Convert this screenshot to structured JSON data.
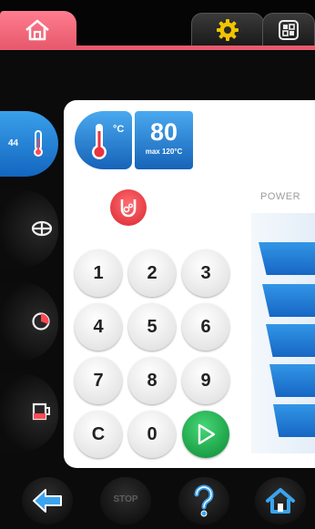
{
  "temperature": {
    "current": "44",
    "setpoint": "80",
    "unit": "°C",
    "max_label": "max 120°C"
  },
  "power": {
    "label": "POWER",
    "levels": 5
  },
  "keypad": {
    "keys": [
      "1",
      "2",
      "3",
      "4",
      "5",
      "6",
      "7",
      "8",
      "9",
      "C",
      "0"
    ]
  },
  "bottom": {
    "stop_label": "STOP"
  },
  "colors": {
    "accent_red": "#e85a6d",
    "accent_blue": "#1a72cf",
    "start_green": "#22a84d",
    "probe_red": "#dd2b34"
  },
  "icons": {
    "top": [
      "home-icon",
      "gear-icon",
      "grid-icon"
    ],
    "rail": [
      "thermometer-icon",
      "fan-icon",
      "timer-icon",
      "cup-icon"
    ],
    "bottom": [
      "back-arrow-icon",
      "stop-icon",
      "help-icon",
      "home-icon"
    ]
  }
}
